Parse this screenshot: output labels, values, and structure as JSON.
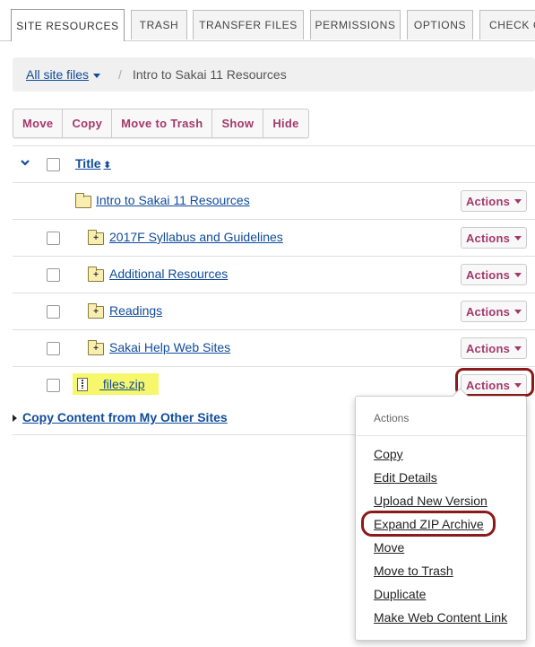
{
  "tabs": [
    {
      "label": "SITE RESOURCES",
      "active": true
    },
    {
      "label": "TRASH"
    },
    {
      "label": "TRANSFER FILES"
    },
    {
      "label": "PERMISSIONS"
    },
    {
      "label": "OPTIONS"
    },
    {
      "label": "CHECK Q"
    }
  ],
  "breadcrumb": {
    "root": "All site files",
    "separator": "/",
    "current": "Intro to Sakai 11 Resources"
  },
  "toolbar": {
    "move": "Move",
    "copy": "Copy",
    "move_to_trash": "Move to Trash",
    "show": "Show",
    "hide": "Hide"
  },
  "table": {
    "title_header": "Title",
    "actions_label": "Actions",
    "items": [
      {
        "name": "Intro to Sakai 11 Resources",
        "kind": "folder"
      },
      {
        "name": "2017F Syllabus and Guidelines",
        "kind": "folder"
      },
      {
        "name": "Additional Resources",
        "kind": "folder"
      },
      {
        "name": "Readings",
        "kind": "folder"
      },
      {
        "name": "Sakai Help Web Sites",
        "kind": "folder"
      },
      {
        "name": " files.zip",
        "kind": "zip"
      }
    ]
  },
  "copy_content": "Copy Content from My Other Sites",
  "actions_menu": {
    "header": "Actions",
    "items": [
      "Copy",
      "Edit Details",
      "Upload New Version",
      "Expand ZIP Archive",
      "Move",
      "Move to Trash",
      "Duplicate",
      "Make Web Content Link"
    ]
  },
  "colors": {
    "link": "#0f4b9b",
    "button_text": "#a3396b",
    "highlight": "#f6f76b",
    "callout_ring": "#8b1a1a"
  }
}
